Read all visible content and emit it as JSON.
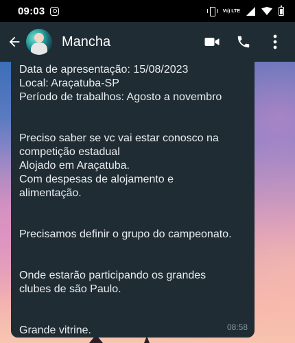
{
  "status_bar": {
    "time": "09:03",
    "network_label": "Vo) LTE"
  },
  "header": {
    "title": "Mancha",
    "icons": [
      "back-arrow-icon",
      "video-call-icon",
      "voice-call-icon",
      "more-options-icon"
    ]
  },
  "message": {
    "lines": [
      "Data de apresentação: 15/08/2023",
      "Local: Araçatuba-SP",
      "Período de trabalhos: Agosto a novembro",
      "",
      "",
      "Preciso saber se vc vai estar conosco na",
      "competição estadual",
      "Alojado em Araçatuba.",
      "Com despesas de alojamento e",
      "alimentação.",
      "",
      "",
      "Precisamos definir o grupo do campeonato.",
      "",
      "",
      "Onde estarão participando os grandes",
      "clubes de são Paulo.",
      "",
      "",
      "Grande vitrine."
    ],
    "time": "08:58"
  },
  "colors": {
    "app_bar": "#1f2c34",
    "bubble": "#202c33",
    "text": "#e9edef",
    "timestamp": "#8696a0"
  }
}
